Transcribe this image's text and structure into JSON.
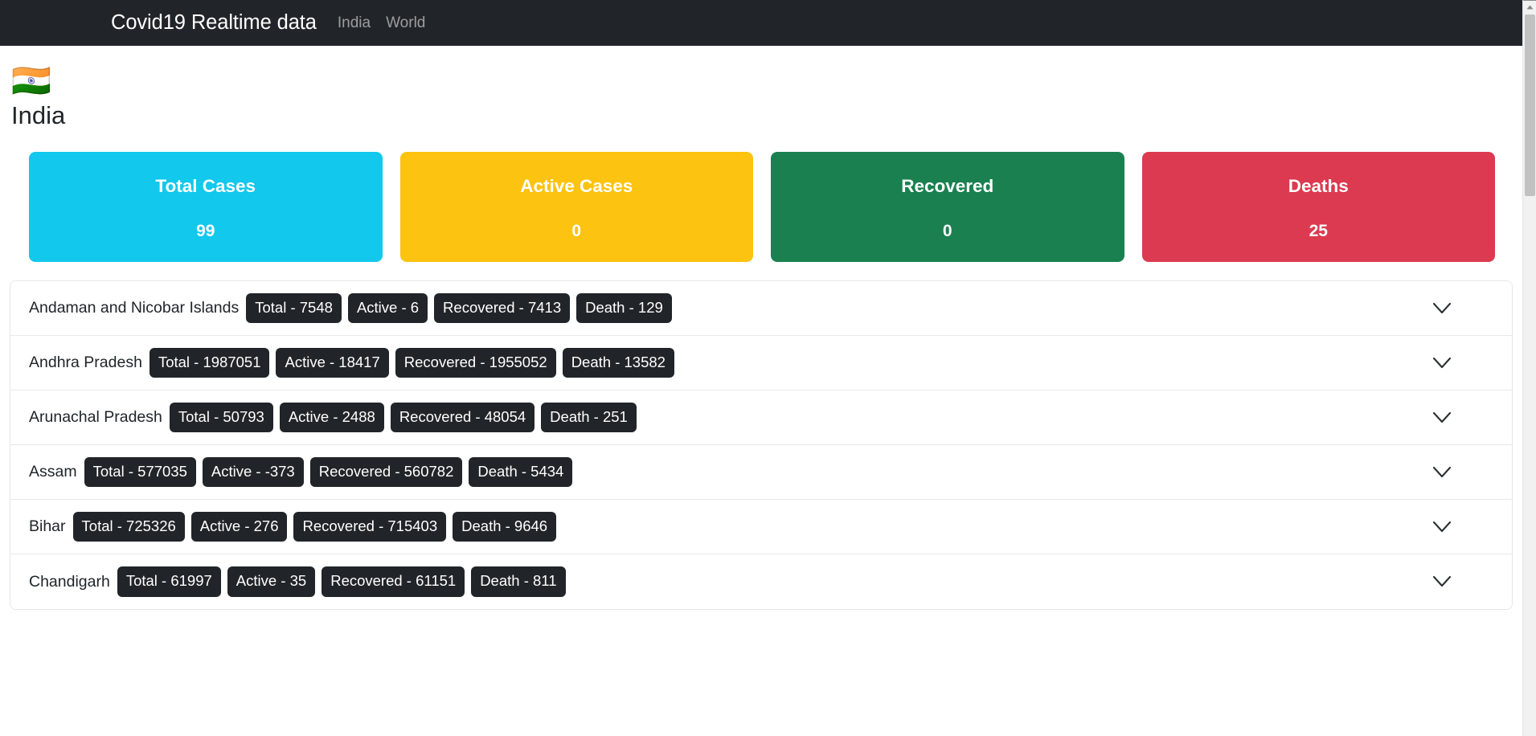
{
  "navbar": {
    "brand": "Covid19 Realtime data",
    "links": [
      {
        "label": "India"
      },
      {
        "label": "World"
      }
    ]
  },
  "country": {
    "flag_icon": "india-flag-emoji",
    "flag_emoji": "🇮🇳",
    "name": "India"
  },
  "summary_cards": [
    {
      "title": "Total Cases",
      "value": "99",
      "color": "#12C8EC"
    },
    {
      "title": "Active Cases",
      "value": "0",
      "color": "#FCC310"
    },
    {
      "title": "Recovered",
      "value": "0",
      "color": "#1A8050"
    },
    {
      "title": "Deaths",
      "value": "25",
      "color": "#DC3A50"
    }
  ],
  "badge_labels": {
    "total": "Total",
    "active": "Active",
    "recovered": "Recovered",
    "death": "Death",
    "separator": " - "
  },
  "states": [
    {
      "name": "Andaman and Nicobar Islands",
      "total": "Total - 7548",
      "active": "Active - 6",
      "recovered": "Recovered - 7413",
      "death": "Death - 129",
      "expand_icon": "chevron-down-icon"
    },
    {
      "name": "Andhra Pradesh",
      "total": "Total - 1987051",
      "active": "Active - 18417",
      "recovered": "Recovered - 1955052",
      "death": "Death - 13582",
      "expand_icon": "chevron-down-icon"
    },
    {
      "name": "Arunachal Pradesh",
      "total": "Total - 50793",
      "active": "Active - 2488",
      "recovered": "Recovered - 48054",
      "death": "Death - 251",
      "expand_icon": "chevron-down-icon"
    },
    {
      "name": "Assam",
      "total": "Total - 577035",
      "active": "Active - -373",
      "recovered": "Recovered - 560782",
      "death": "Death - 5434",
      "expand_icon": "chevron-down-icon"
    },
    {
      "name": "Bihar",
      "total": "Total - 725326",
      "active": "Active - 276",
      "recovered": "Recovered - 715403",
      "death": "Death - 9646",
      "expand_icon": "chevron-down-icon"
    },
    {
      "name": "Chandigarh",
      "total": "Total - 61997",
      "active": "Active - 35",
      "recovered": "Recovered - 61151",
      "death": "Death - 811",
      "expand_icon": "chevron-down-icon"
    }
  ],
  "scrollbar": {
    "up_arrow_icon": "scroll-up-arrow-icon"
  }
}
